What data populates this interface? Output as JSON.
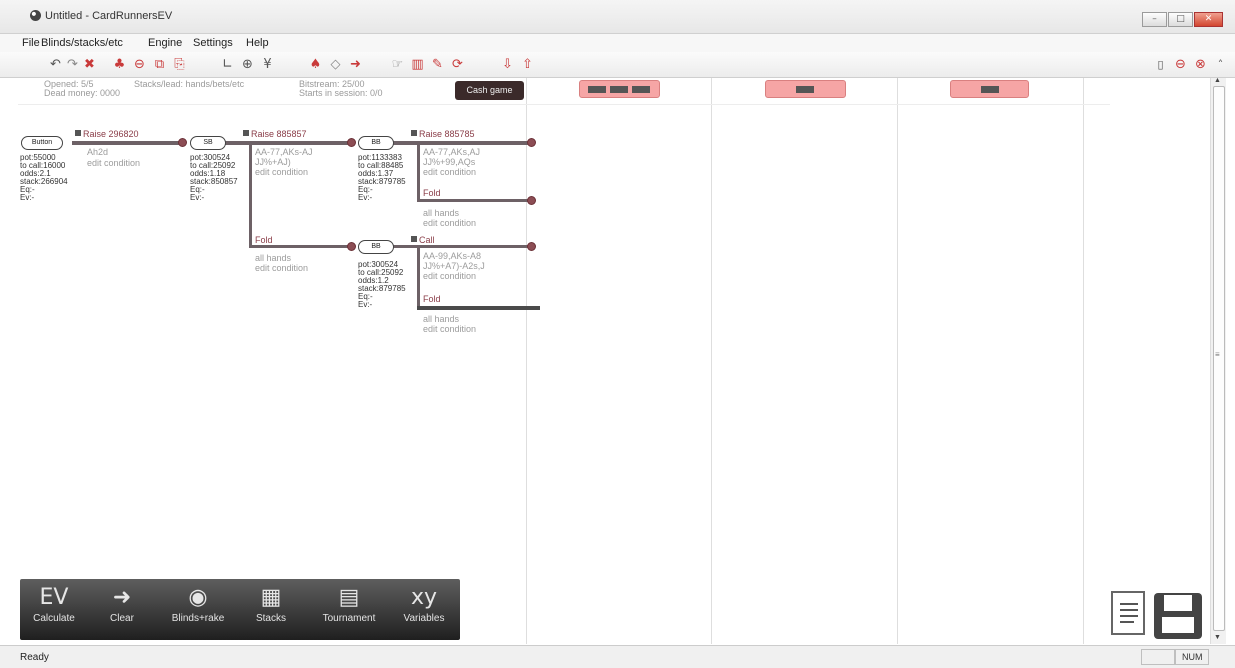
{
  "window": {
    "title": "Untitled - CardRunnersEV",
    "min": "–",
    "max": "□",
    "close": "✕"
  },
  "menu": [
    "File",
    "Blinds/stacks/etc",
    "Engine",
    "Settings",
    "Help"
  ],
  "tooltip": "Cash game",
  "header_faded": {
    "a1": "Opened: 5/5",
    "a2": "Dead money: 0000",
    "b1": "Stacks/lead: hands/bets/etc",
    "c1": "Bitstream: 25/00",
    "c2": "Starts in session: 0/0"
  },
  "tree": {
    "button": {
      "label": "Button",
      "action": "Raise 296820",
      "range": "Ah2d",
      "cond": "edit condition",
      "stats": [
        "pot:55000",
        "to call:16000",
        "odds:2.1",
        "stack:266904",
        "Eq:-",
        "Ev:-"
      ]
    },
    "sb1": {
      "label": "SB",
      "action": "Raise 885857",
      "range": "AA-77,AKs-AJ",
      "range2": "JJ%+AJ)",
      "cond": "edit condition",
      "stats": [
        "pot:300524",
        "to call:25092",
        "odds:1.18",
        "stack:850857",
        "Eq:-",
        "Ev:-"
      ],
      "fold": "Fold",
      "fold_range": "all hands",
      "fold_cond": "edit condition"
    },
    "bb1": {
      "label": "BB",
      "action": "Raise 885785",
      "range": "AA-77,AKs,AJ",
      "range2": "JJ%+99,AQs",
      "cond": "edit condition",
      "stats": [
        "pot:1133383",
        "to call:88485",
        "odds:1.37",
        "stack:879785",
        "Eq:-",
        "Ev:-"
      ],
      "fold": "Fold",
      "fold_range": "all hands",
      "fold_cond": "edit condition"
    },
    "bb2": {
      "label": "BB",
      "action": "Call",
      "range": "AA-99,AKs-A8",
      "range2": "JJ%+A7)-A2s,J",
      "cond": "edit condition",
      "stats": [
        "pot:300524",
        "to call:25092",
        "odds:1.2",
        "stack:879785",
        "Eq:-",
        "Ev:-"
      ],
      "fold": "Fold",
      "fold_range": "all hands",
      "fold_cond": "edit condition"
    }
  },
  "bottom_buttons": [
    {
      "id": "calculate",
      "label": "Calculate",
      "icon": "EV"
    },
    {
      "id": "clear",
      "label": "Clear",
      "icon": "➜"
    },
    {
      "id": "blinds",
      "label": "Blinds+rake",
      "icon": "◉"
    },
    {
      "id": "stacks",
      "label": "Stacks",
      "icon": "▦"
    },
    {
      "id": "tournament",
      "label": "Tournament",
      "icon": "▤"
    },
    {
      "id": "variables",
      "label": "Variables",
      "icon": "xy"
    }
  ],
  "status": {
    "left": "Ready",
    "num": "NUM"
  }
}
